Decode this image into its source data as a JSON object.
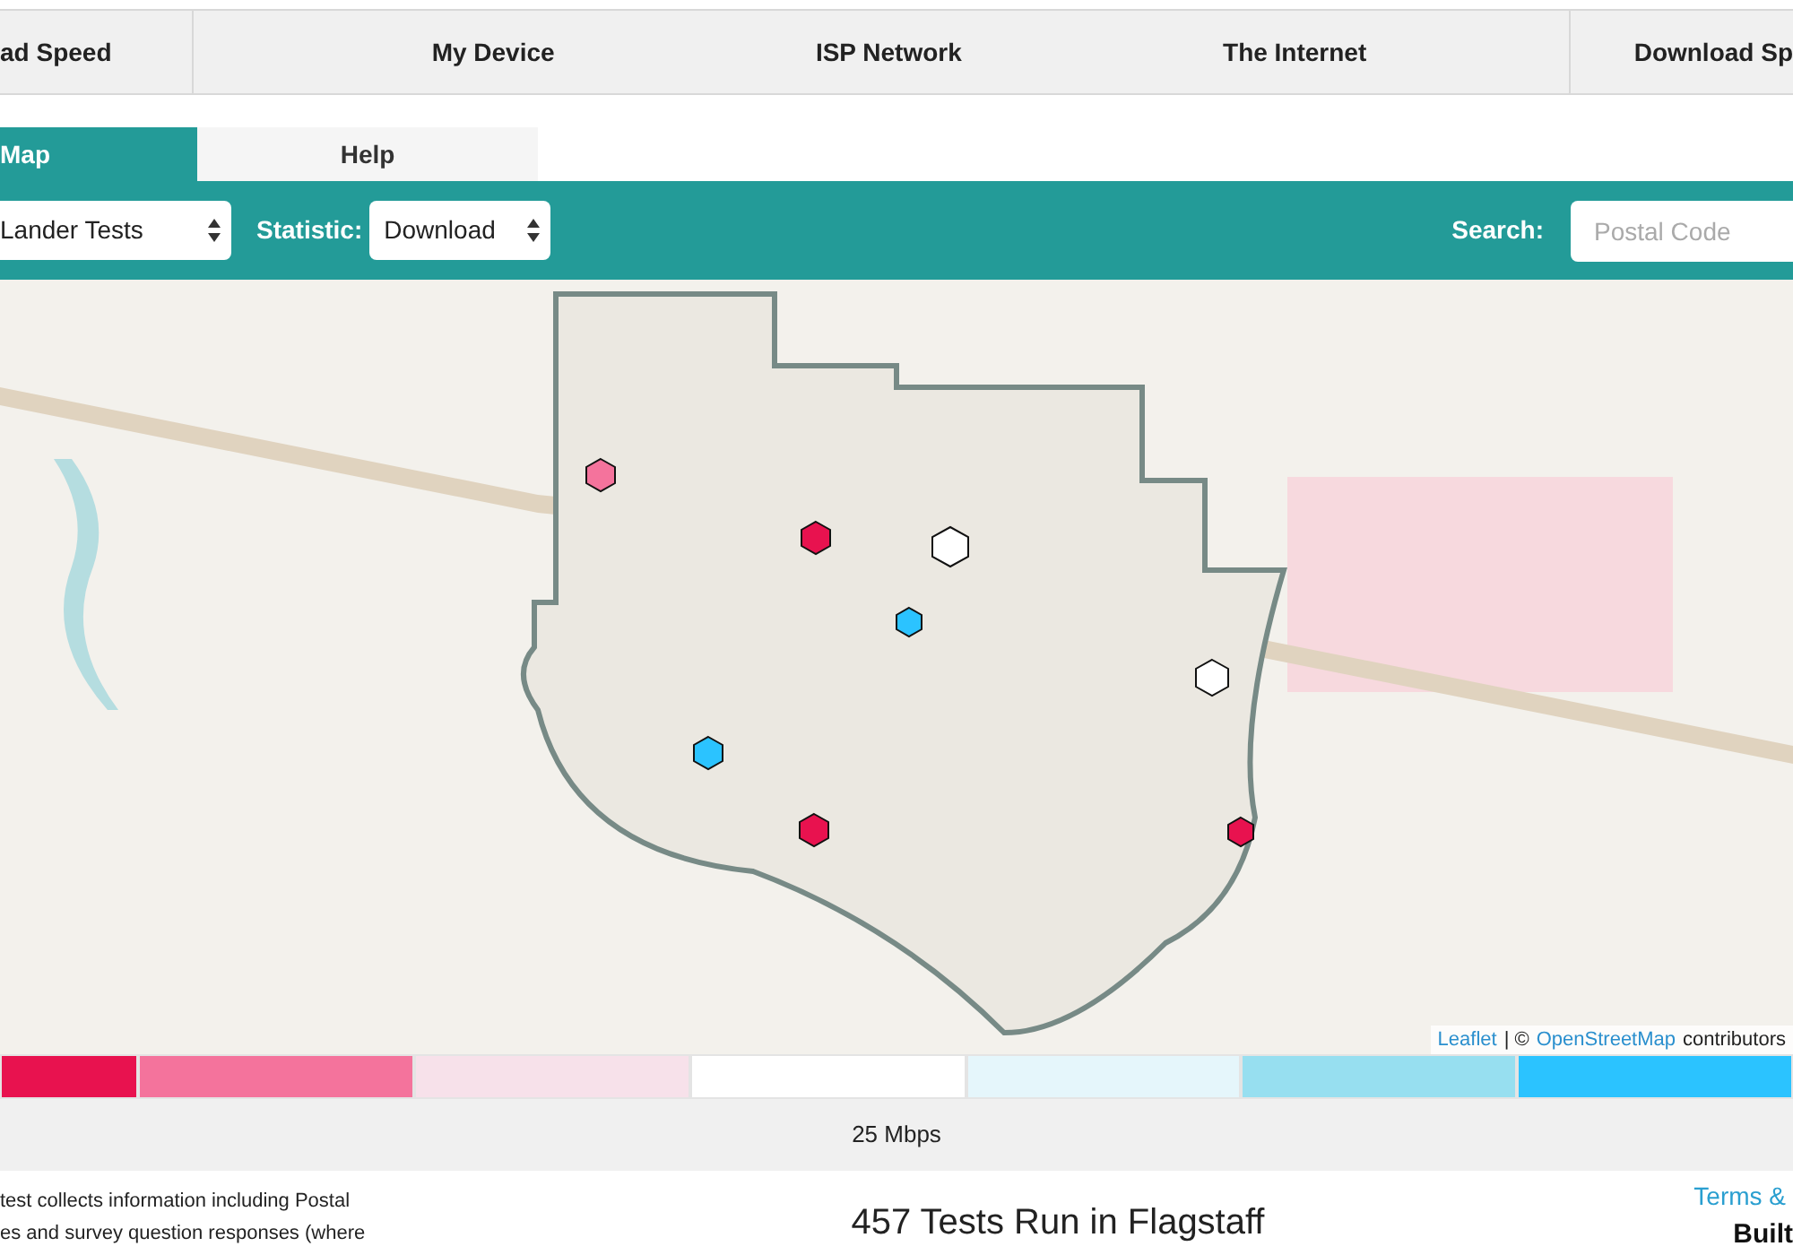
{
  "nav": [
    {
      "label": "ad Speed"
    },
    {
      "label": "My Device"
    },
    {
      "label": "ISP Network"
    },
    {
      "label": "The Internet"
    },
    {
      "label": "Download Sp"
    }
  ],
  "tabs": [
    {
      "label": "Map",
      "selected": true
    },
    {
      "label": "Help",
      "selected": false
    }
  ],
  "toolbar": {
    "dataset_select": "Lander Tests",
    "statistic_label": "Statistic:",
    "statistic_select": "Download",
    "search_label": "Search:",
    "search_placeholder": "Postal Code"
  },
  "map": {
    "attribution": [
      {
        "kind": "link",
        "text": "Leaflet"
      },
      {
        "kind": "text",
        "text": "| ©"
      },
      {
        "kind": "link",
        "text": "OpenStreetMap"
      },
      {
        "kind": "text",
        "text": "contributors"
      }
    ]
  },
  "legend": {
    "bins": [
      {
        "color": "#e8124f"
      },
      {
        "color": "#f4739c"
      },
      {
        "color": "#f7e1ea"
      },
      {
        "color": "#ffffff"
      },
      {
        "color": "#e5f6fb"
      },
      {
        "color": "#97dff0"
      },
      {
        "color": "#2bc3ff"
      }
    ],
    "label": "25 Mbps"
  },
  "footer": {
    "notice": [
      "test collects information including Postal",
      "es and survey question responses (where"
    ],
    "title": "457 Tests Run in Flagstaff",
    "terms_link": "Terms &",
    "built": "Built"
  }
}
